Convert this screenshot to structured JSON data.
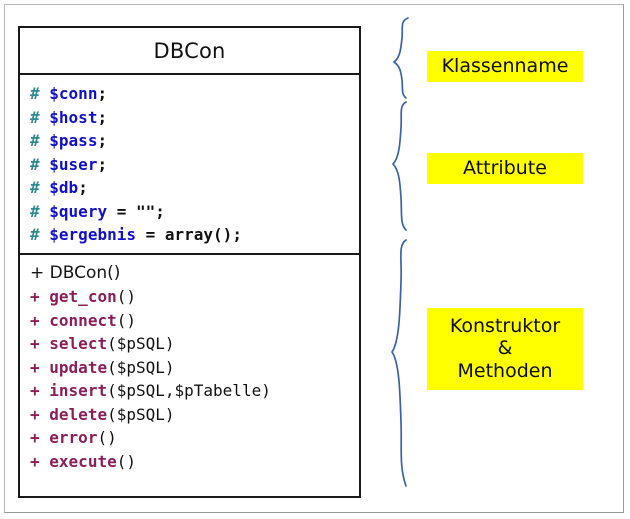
{
  "diagram": {
    "type": "uml-class-diagram",
    "class_name": "DBCon",
    "colors": {
      "class_border": "#1a1a1a",
      "protected_marker": "#2e8b8b",
      "attribute_name": "#1111cc",
      "public_marker": "#8c1f58",
      "method_name": "#8c1f58",
      "punctuation": "#111111",
      "brace": "#3a62a8",
      "highlight": "#ffff00",
      "page_background": "#ffffff"
    }
  },
  "class_box": {
    "title": "DBCon",
    "attributes": [
      {
        "visibility": "#",
        "name": "$conn",
        "assign": "",
        "terminator": ";"
      },
      {
        "visibility": "#",
        "name": "$host",
        "assign": "",
        "terminator": ";"
      },
      {
        "visibility": "#",
        "name": "$pass",
        "assign": "",
        "terminator": ";"
      },
      {
        "visibility": "#",
        "name": "$user",
        "assign": "",
        "terminator": ";"
      },
      {
        "visibility": "#",
        "name": "$db",
        "assign": "",
        "terminator": ";"
      },
      {
        "visibility": "#",
        "name": "$query",
        "assign": " = \"\"",
        "terminator": ";"
      },
      {
        "visibility": "#",
        "name": "$ergebnis",
        "assign": " = array()",
        "terminator": ";"
      }
    ],
    "methods": [
      {
        "visibility": "+",
        "name": "DBCon",
        "params": "()",
        "is_constructor": true
      },
      {
        "visibility": "+",
        "name": "get_con",
        "params": "()",
        "is_constructor": false
      },
      {
        "visibility": "+",
        "name": "connect",
        "params": "()",
        "is_constructor": false
      },
      {
        "visibility": "+",
        "name": "select",
        "params": "($pSQL)",
        "is_constructor": false
      },
      {
        "visibility": "+",
        "name": "update",
        "params": "($pSQL)",
        "is_constructor": false
      },
      {
        "visibility": "+",
        "name": "insert",
        "params": "($pSQL,$pTabelle)",
        "is_constructor": false
      },
      {
        "visibility": "+",
        "name": "delete",
        "params": "($pSQL)",
        "is_constructor": false
      },
      {
        "visibility": "+",
        "name": "error",
        "params": "()",
        "is_constructor": false
      },
      {
        "visibility": "+",
        "name": "execute",
        "params": "()",
        "is_constructor": false
      }
    ]
  },
  "annotations": {
    "labels": [
      {
        "id": "klassenname",
        "lines": [
          "Klassenname"
        ]
      },
      {
        "id": "attribute",
        "lines": [
          "Attribute"
        ]
      },
      {
        "id": "methoden",
        "lines": [
          "Konstruktor",
          "&",
          "Methoden"
        ]
      }
    ]
  }
}
